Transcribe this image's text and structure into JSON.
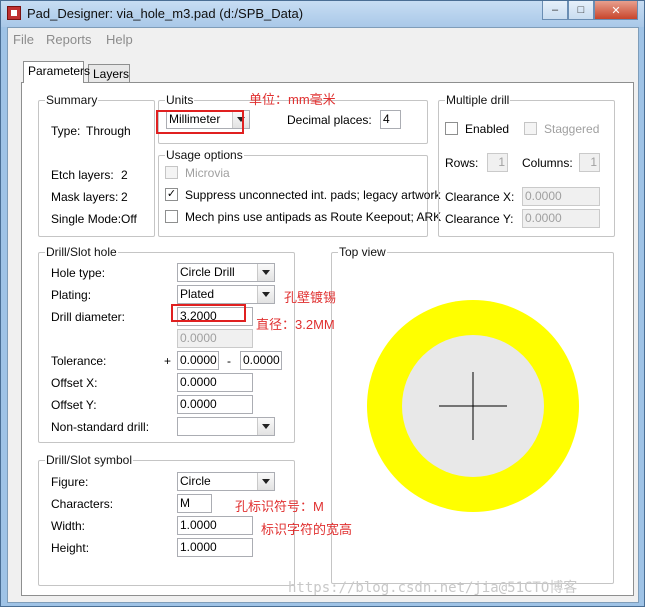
{
  "window": {
    "title": "Pad_Designer: via_hole_m3.pad (d:/SPB_Data)",
    "minimize_glyph": "–",
    "maximize_glyph": "□",
    "close_glyph": "✕"
  },
  "menu": {
    "file": "File",
    "reports": "Reports",
    "help": "Help"
  },
  "tabs": {
    "parameters": "Parameters",
    "layers": "Layers"
  },
  "summary": {
    "title": "Summary",
    "type_label": "Type:",
    "type_value": "Through",
    "etch_label": "Etch layers:",
    "etch_value": "2",
    "mask_label": "Mask layers:",
    "mask_value": "2",
    "single_label": "Single Mode:",
    "single_value": "Off"
  },
  "units": {
    "title": "Units",
    "selected": "Millimeter",
    "decimal_label": "Decimal places:",
    "decimal_value": "4"
  },
  "usage": {
    "title": "Usage options",
    "microvia": "Microvia",
    "suppress": "Suppress unconnected int. pads; legacy artwork",
    "suppress_checked": "✓",
    "mech": "Mech pins use antipads as Route Keepout; ARK"
  },
  "multiple_drill": {
    "title": "Multiple drill",
    "enabled": "Enabled",
    "staggered": "Staggered",
    "rows_label": "Rows:",
    "rows_value": "1",
    "columns_label": "Columns:",
    "columns_value": "1",
    "clearance_x_label": "Clearance X:",
    "clearance_x_value": "0.0000",
    "clearance_y_label": "Clearance Y:",
    "clearance_y_value": "0.0000"
  },
  "drill_hole": {
    "title": "Drill/Slot hole",
    "hole_type_label": "Hole type:",
    "hole_type_value": "Circle Drill",
    "plating_label": "Plating:",
    "plating_value": "Plated",
    "diameter_label": "Drill diameter:",
    "diameter_value": "3.2000",
    "diameter2_value": "0.0000",
    "tolerance_label": "Tolerance:",
    "plus": "+",
    "tol_plus_value": "0.0000",
    "minus": "-",
    "tol_minus_value": "0.0000",
    "offset_x_label": "Offset X:",
    "offset_x_value": "0.0000",
    "offset_y_label": "Offset Y:",
    "offset_y_value": "0.0000",
    "nonstd_label": "Non-standard drill:",
    "nonstd_value": ""
  },
  "drill_symbol": {
    "title": "Drill/Slot symbol",
    "figure_label": "Figure:",
    "figure_value": "Circle",
    "characters_label": "Characters:",
    "characters_value": "M",
    "width_label": "Width:",
    "width_value": "1.0000",
    "height_label": "Height:",
    "height_value": "1.0000"
  },
  "top_view": {
    "title": "Top view",
    "ring_color": "#ffff00",
    "hole_color": "#e8e8e8"
  },
  "annotations": {
    "units_note": "单位：mm毫米",
    "plating_note": "孔壁镀锡",
    "diameter_note": "直径：3.2MM",
    "characters_note": "孔标识符号：M",
    "size_note": "标识字符的宽高",
    "color": "#e03030"
  },
  "watermark": "https://blog.csdn.net/jia@51CTO博客"
}
